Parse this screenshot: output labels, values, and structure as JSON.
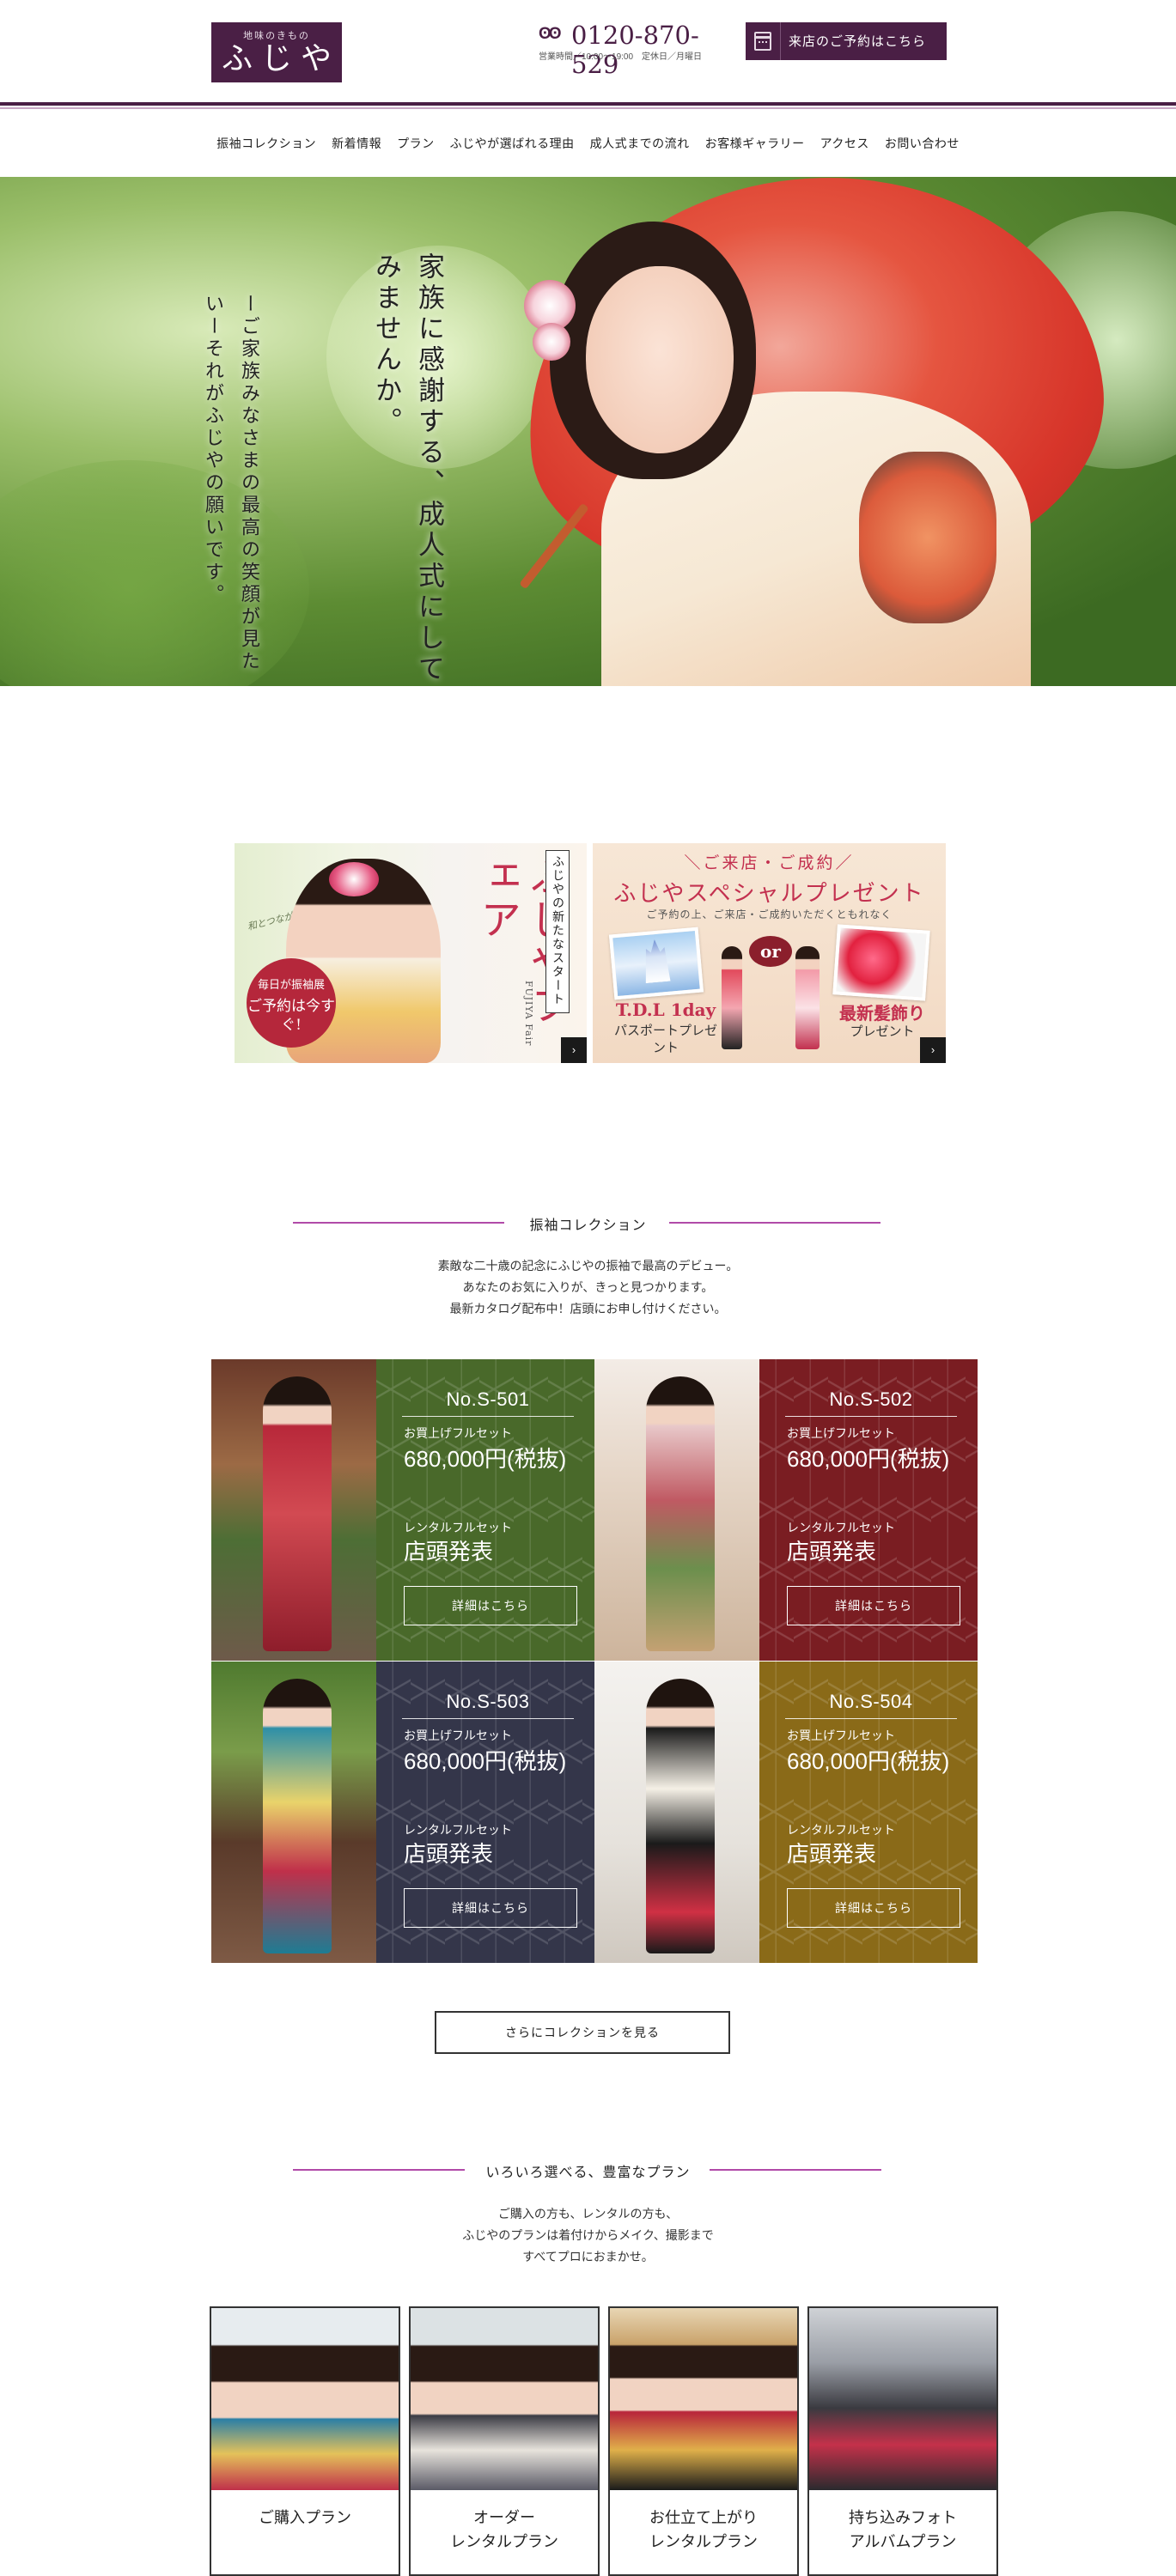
{
  "header": {
    "logo_sub": "地味のきもの",
    "logo_main": "ふじや",
    "phone_icon": "ʘʘ",
    "phone_number": "0120-870-529",
    "phone_hours": "営業時間／10:00〜19:00　定休日／月曜日",
    "reserve_label": "来店のご予約はこちら"
  },
  "nav": {
    "items": [
      "振袖コレクション",
      "新着情報",
      "プラン",
      "ふじやが選ばれる理由",
      "成人式までの流れ",
      "お客様ギャラリー",
      "アクセス",
      "お問い合わせ"
    ]
  },
  "hero": {
    "copy_main": "家族に感謝する、成人式にしてみませんか。",
    "copy_sub": "ーご家族みなさまの最高の笑顔が見たいーそれがふじやの願いです。"
  },
  "banners": {
    "fair": {
      "script": "和とつながる…",
      "title": "ふじやフェア",
      "vertical": "ふじやの新たなスタート",
      "en": "FUJIYA Fair",
      "circle_l1": "毎日が振袖展",
      "circle_l2": "ご予約は今すぐ!",
      "arrow": "›"
    },
    "present": {
      "top": "＼ご来店・ご成約／",
      "title": "ふじやスペシャルプレゼント",
      "sub": "ご予約の上、ご来店・ご成約いただくともれなく",
      "or": "or",
      "left_title": "T.D.L 1day",
      "left_sub": "パスポートプレゼント",
      "right_title": "最新髪飾り",
      "right_sub": "プレゼント",
      "arrow": "›"
    }
  },
  "collection": {
    "heading": "振袖コレクション",
    "desc": [
      "素敵な二十歳の記念にふじやの振袖で最高のデビュー。",
      "あなたのお気に入りが、きっと見つかります。",
      "最新カタログ配布中！店頭にお申し付けください。"
    ],
    "items": [
      {
        "no": "No.S-501",
        "buy_label": "お買上げフルセット",
        "buy_price": "680,000円(税抜)",
        "rent_label": "レンタルフルセット",
        "rent_price": "店頭発表",
        "btn": "詳細はこちら",
        "color": "#49692a"
      },
      {
        "no": "No.S-502",
        "buy_label": "お買上げフルセット",
        "buy_price": "680,000円(税抜)",
        "rent_label": "レンタルフルセット",
        "rent_price": "店頭発表",
        "btn": "詳細はこちら",
        "color": "#7a1d22"
      },
      {
        "no": "No.S-503",
        "buy_label": "お買上げフルセット",
        "buy_price": "680,000円(税抜)",
        "rent_label": "レンタルフルセット",
        "rent_price": "店頭発表",
        "btn": "詳細はこちら",
        "color": "#34364a"
      },
      {
        "no": "No.S-504",
        "buy_label": "お買上げフルセット",
        "buy_price": "680,000円(税抜)",
        "rent_label": "レンタルフルセット",
        "rent_price": "店頭発表",
        "btn": "詳細はこちら",
        "color": "#8a6a18"
      }
    ],
    "more_btn": "さらにコレクションを見る"
  },
  "plans": {
    "heading": "いろいろ選べる、豊富なプラン",
    "desc": [
      "ご購入の方も、レンタルの方も、",
      "ふじやのプランは着付けからメイク、撮影まで",
      "すべてプロにおまかせ。"
    ],
    "items": [
      {
        "label_l1": "ご購入プラン",
        "label_l2": ""
      },
      {
        "label_l1": "オーダー",
        "label_l2": "レンタルプラン"
      },
      {
        "label_l1": "お仕立て上がり",
        "label_l2": "レンタルプラン"
      },
      {
        "label_l1": "持ち込みフォト",
        "label_l2": "アルバムプラン"
      }
    ]
  },
  "colors": {
    "brand": "#4a1f45",
    "accent_line": "#b14aa8",
    "red": "#c3304f"
  }
}
